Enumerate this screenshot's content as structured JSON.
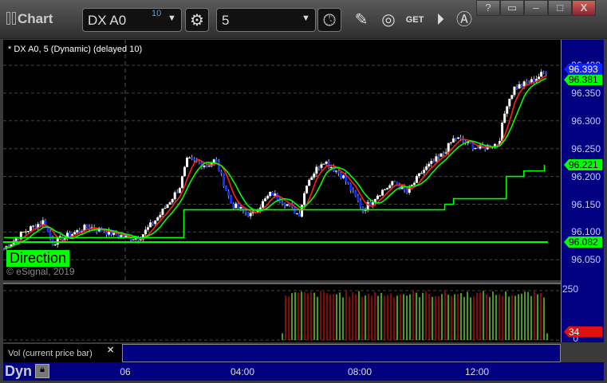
{
  "window": {
    "title": "Chart",
    "symbol": "DX A0",
    "symbol_badge": "10",
    "interval": "5",
    "help": "?",
    "close": "X"
  },
  "toolbar": {
    "icons": [
      "settings-gear-icon",
      "clock-icon",
      "pencil-icon",
      "study-icon",
      "get-icon",
      "play-icon",
      "alert-icon"
    ]
  },
  "chart": {
    "header": "* DX A0, 5 (Dynamic) (delayed 10)",
    "copyright": "© eSignal, 2019",
    "direction_label": "Direction"
  },
  "price_axis": {
    "labels": [
      "96.400",
      "96.350",
      "96.300",
      "96.250",
      "96.200",
      "96.150",
      "96.100",
      "96.050"
    ],
    "last_price": "96.393",
    "ma_value": "96.381",
    "stop_value": "96.221",
    "line_value": "96.082"
  },
  "volume": {
    "label": "Vol (current price bar)",
    "axis_labels": [
      "250",
      "0"
    ],
    "last": "34"
  },
  "time_axis": {
    "labels": [
      "06",
      "04:00",
      "08:00",
      "12:00"
    ],
    "mode": "Dyn"
  },
  "colors": {
    "up": "#ffffff",
    "down": "#1030ff",
    "ma_fast": "#00ff00",
    "ma_red": "#ff2020",
    "axis_bg": "#000080",
    "vol_up": "#80ff30",
    "vol_down": "#e01010"
  },
  "chart_data": {
    "type": "candlestick",
    "hours_since_06": [
      -4.14,
      -3.46,
      -2.78,
      -2.5,
      -2.1,
      -1.28,
      0.08,
      0.49,
      1.17,
      1.85,
      2.12,
      2.8,
      3.07,
      3.62,
      4.3,
      4.98,
      5.52,
      5.93,
      6.2,
      6.75,
      7.43,
      8.11,
      8.65,
      9.2,
      9.6,
      10.15,
      10.83,
      11.24,
      12.06,
      12.74,
      13.01,
      13.28,
      13.83,
      14.37
    ],
    "closes": [
      96.07,
      96.1,
      96.12,
      96.08,
      96.09,
      96.11,
      96.09,
      96.09,
      96.13,
      96.18,
      96.23,
      96.22,
      96.23,
      96.15,
      96.13,
      96.17,
      96.15,
      96.13,
      96.19,
      96.23,
      96.2,
      96.14,
      96.17,
      96.19,
      96.17,
      96.21,
      96.24,
      96.27,
      96.25,
      96.26,
      96.33,
      96.36,
      96.37,
      96.39
    ],
    "stop_line": [
      [
        -4.14,
        96.09
      ],
      [
        0.1,
        96.09
      ],
      [
        2.0,
        96.14
      ],
      [
        10.6,
        96.14
      ],
      [
        10.9,
        96.15
      ],
      [
        11.2,
        96.16
      ],
      [
        12.9,
        96.16
      ],
      [
        13.0,
        96.2
      ],
      [
        13.6,
        96.21
      ],
      [
        14.3,
        96.221
      ]
    ],
    "hline": 96.082,
    "ylim": [
      96.03,
      96.42
    ]
  }
}
